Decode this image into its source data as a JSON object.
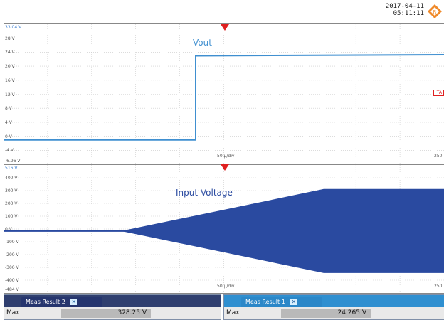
{
  "header": {
    "date": "2017-04-11",
    "time": "05:11:11",
    "logo_icon": "rohde-schwarz-logo-icon"
  },
  "panel_top": {
    "signal_label": "Vout",
    "signal_color": "#3f8fd0",
    "y_labels": [
      "33.04 V",
      "28 V",
      "24 V",
      "20 V",
      "16 V",
      "12 V",
      "8 V",
      "4 V",
      "0 V",
      "-4 V",
      "-6.96 V"
    ],
    "x_scale": "50 µ/div",
    "x_right": "250",
    "trigger_marker": "TA"
  },
  "panel_bottom": {
    "signal_label": "Input Voltage",
    "signal_color": "#2a4aa0",
    "y_labels": [
      "516 V",
      "400 V",
      "300 V",
      "200 V",
      "100 V",
      "0 V",
      "-100 V",
      "-200 V",
      "-300 V",
      "-400 V",
      "-484 V"
    ],
    "x_scale": "50 µ/div",
    "x_right": "250"
  },
  "measurements": [
    {
      "tab": "Meas Result 2",
      "name": "Max",
      "value": "328.25 V"
    },
    {
      "tab": "Meas Result 1",
      "name": "Max",
      "value": "24.265 V"
    }
  ],
  "chart_data": [
    {
      "type": "line",
      "title": "",
      "series": [
        {
          "name": "Vout",
          "x": [
            0,
            223,
            224,
            619
          ],
          "y": [
            0,
            0,
            24,
            24.3
          ]
        }
      ],
      "ylim": [
        -6.96,
        33.04
      ],
      "ylabel": "",
      "xlabel": ""
    },
    {
      "type": "area",
      "title": "",
      "series": [
        {
          "name": "Input Voltage",
          "envelope_x": [
            0,
            160,
            310,
            450,
            619
          ],
          "envelope_amplitude": [
            0,
            0,
            180,
            328,
            328
          ]
        }
      ],
      "ylim": [
        -484,
        516
      ],
      "ylabel": "",
      "xlabel": ""
    }
  ]
}
